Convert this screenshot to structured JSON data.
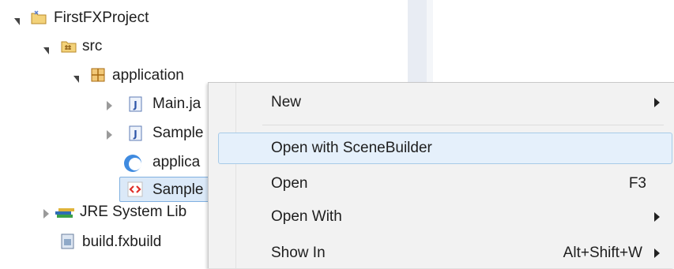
{
  "tree": {
    "items": [
      {
        "label": "FirstFXProject",
        "icon": "project-folder-icon",
        "twisty": "expanded"
      },
      {
        "label": "src",
        "icon": "source-folder-icon",
        "twisty": "expanded"
      },
      {
        "label": "application",
        "icon": "package-icon",
        "twisty": "expanded"
      },
      {
        "label": "Main.ja",
        "icon": "java-file-icon",
        "twisty": "collapsed"
      },
      {
        "label": "Sample",
        "icon": "java-file-icon",
        "twisty": "collapsed"
      },
      {
        "label": "applica",
        "icon": "css-file-icon",
        "twisty": "none"
      },
      {
        "label": "Sample",
        "icon": "fxml-file-icon",
        "twisty": "none",
        "selected": true
      },
      {
        "label": "JRE System Lib",
        "icon": "library-icon",
        "twisty": "collapsed"
      },
      {
        "label": "build.fxbuild",
        "icon": "fxbuild-file-icon",
        "twisty": "none"
      }
    ]
  },
  "context_menu": {
    "items": [
      {
        "label": "New",
        "accelerator": "",
        "submenu": true
      },
      {
        "label": "Open with SceneBuilder",
        "accelerator": "",
        "submenu": false,
        "highlighted": true
      },
      {
        "label": "Open",
        "accelerator": "F3",
        "submenu": false
      },
      {
        "label": "Open With",
        "accelerator": "",
        "submenu": true
      },
      {
        "label": "Show In",
        "accelerator": "Alt+Shift+W",
        "submenu": true
      }
    ]
  },
  "colors": {
    "selection": "#dbe9f8",
    "menu_background": "#f2f2f2",
    "menu_highlight": "#e5f0fb"
  }
}
